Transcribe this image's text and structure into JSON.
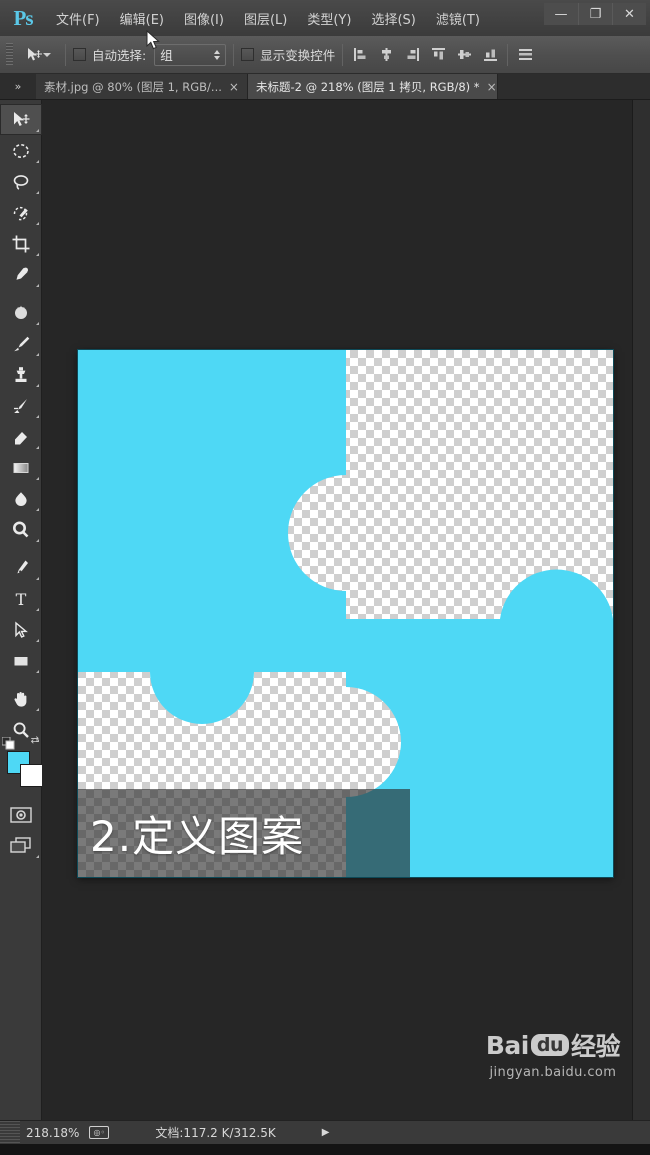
{
  "app": {
    "logo": "Ps",
    "menus": [
      {
        "label": "文件(F)",
        "name": "menu-file"
      },
      {
        "label": "编辑(E)",
        "name": "menu-edit"
      },
      {
        "label": "图像(I)",
        "name": "menu-image"
      },
      {
        "label": "图层(L)",
        "name": "menu-layer"
      },
      {
        "label": "类型(Y)",
        "name": "menu-type"
      },
      {
        "label": "选择(S)",
        "name": "menu-select"
      },
      {
        "label": "滤镜(T)",
        "name": "menu-filter"
      }
    ],
    "window_controls": {
      "minimize": "—",
      "maximize": "❐",
      "close": "✕"
    }
  },
  "options_bar": {
    "tool_icon": "move-tool-icon",
    "auto_select_checked": false,
    "auto_select_label": "自动选择:",
    "group_select_value": "组",
    "show_transform_checked": false,
    "show_transform_label": "显示变换控件",
    "align_buttons": [
      "align-left-edges",
      "align-horizontal-centers",
      "align-right-edges",
      "align-top-edges",
      "align-vertical-centers",
      "align-bottom-edges",
      "distribute-top-edges"
    ]
  },
  "tabs": {
    "collapse_icon": "»",
    "items": [
      {
        "title": "素材.jpg @ 80% (图层 1, RGB/...",
        "close": "×",
        "active": false
      },
      {
        "title": "未标题-2 @ 218% (图层 1 拷贝, RGB/8) *",
        "close": "×",
        "active": true
      }
    ]
  },
  "toolbox": {
    "tools": [
      {
        "name": "move-tool",
        "selected": true
      },
      {
        "name": "elliptical-marquee-tool",
        "selected": false
      },
      {
        "name": "lasso-tool",
        "selected": false
      },
      {
        "name": "quick-selection-tool",
        "selected": false
      },
      {
        "name": "crop-tool",
        "selected": false
      },
      {
        "name": "eyedropper-tool",
        "selected": false
      },
      {
        "name": "spot-healing-brush-tool",
        "selected": false
      },
      {
        "name": "brush-tool",
        "selected": false
      },
      {
        "name": "clone-stamp-tool",
        "selected": false
      },
      {
        "name": "history-brush-tool",
        "selected": false
      },
      {
        "name": "eraser-tool",
        "selected": false
      },
      {
        "name": "gradient-tool",
        "selected": false
      },
      {
        "name": "blur-tool",
        "selected": false
      },
      {
        "name": "dodge-tool",
        "selected": false
      },
      {
        "name": "pen-tool",
        "selected": false
      },
      {
        "name": "horizontal-type-tool",
        "selected": false
      },
      {
        "name": "path-selection-tool",
        "selected": false
      },
      {
        "name": "rectangle-tool",
        "selected": false
      },
      {
        "name": "hand-tool",
        "selected": false
      },
      {
        "name": "zoom-tool",
        "selected": false
      }
    ],
    "type_tool_glyph": "T",
    "foreground_color": "#4ed8f5",
    "background_color": "#ffffff"
  },
  "canvas": {
    "caption": "2.定义图案",
    "puzzle_color": "#4ed8f5",
    "checker_light": "#ffffff",
    "checker_dark": "#cfcfcf"
  },
  "watermark": {
    "brand_prefix": "Bai",
    "brand_bubble": "du",
    "brand_suffix": "经验",
    "url": "jingyan.baidu.com"
  },
  "status_bar": {
    "zoom": "218.18%",
    "zoom_glyph": "doc-size-icon",
    "document_info": "文档:117.2 K/312.5K",
    "expand_arrow": "▶"
  }
}
